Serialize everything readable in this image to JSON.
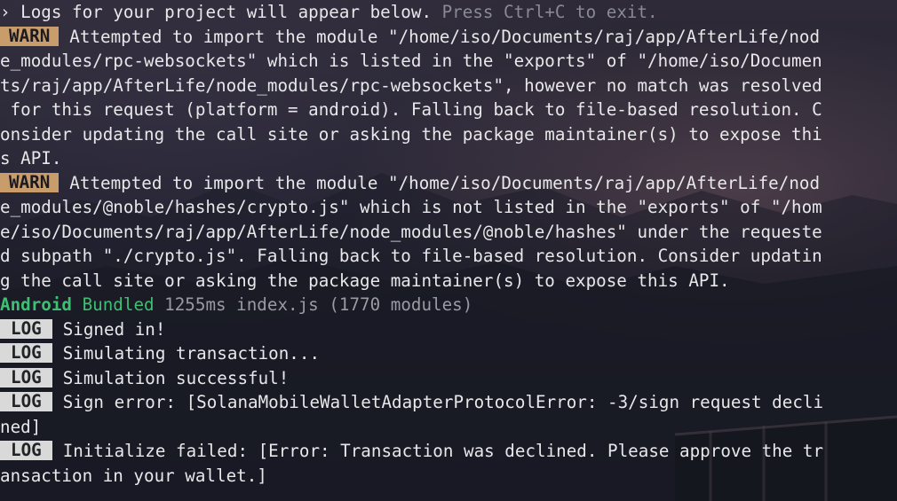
{
  "terminal": {
    "prompt_symbol": "›",
    "intro_text": " Logs for your project will appear below. ",
    "intro_hint": "Press Ctrl+C to exit.",
    "warn_label": "WARN",
    "log_label": "LOG",
    "warn1": {
      "line1": "Attempted to import the module \"/home/iso/Documents/raj/app/AfterLife/nod",
      "line2": "e_modules/rpc-websockets\" which is listed in the \"exports\" of \"/home/iso/Documen",
      "line3": "ts/raj/app/AfterLife/node_modules/rpc-websockets\", however no match was resolved",
      "line4": " for this request (platform = android). Falling back to file-based resolution. C",
      "line5": "onsider updating the call site or asking the package maintainer(s) to expose thi",
      "line6": "s API."
    },
    "warn2": {
      "line1": "Attempted to import the module \"/home/iso/Documents/raj/app/AfterLife/nod",
      "line2": "e_modules/@noble/hashes/crypto.js\" which is not listed in the \"exports\" of \"/hom",
      "line3": "e/iso/Documents/raj/app/AfterLife/node_modules/@noble/hashes\" under the requeste",
      "line4": "d subpath \"./crypto.js\". Falling back to file-based resolution. Consider updatin",
      "line5": "g the call site or asking the package maintainer(s) to expose this API."
    },
    "bundle": {
      "platform": "Android",
      "status": " Bundled",
      "details": " 1255ms index.js (1770 modules)"
    },
    "logs": {
      "log1": "Signed in!",
      "log2": "Simulating transaction...",
      "log3": "Simulation successful!",
      "log4_line1": "Sign error: [SolanaMobileWalletAdapterProtocolError: -3/sign request decli",
      "log4_line2": "ned]",
      "log5_line1": "Initialize failed: [Error: Transaction was declined. Please approve the tr",
      "log5_line2": "ansaction in your wallet.]"
    }
  }
}
